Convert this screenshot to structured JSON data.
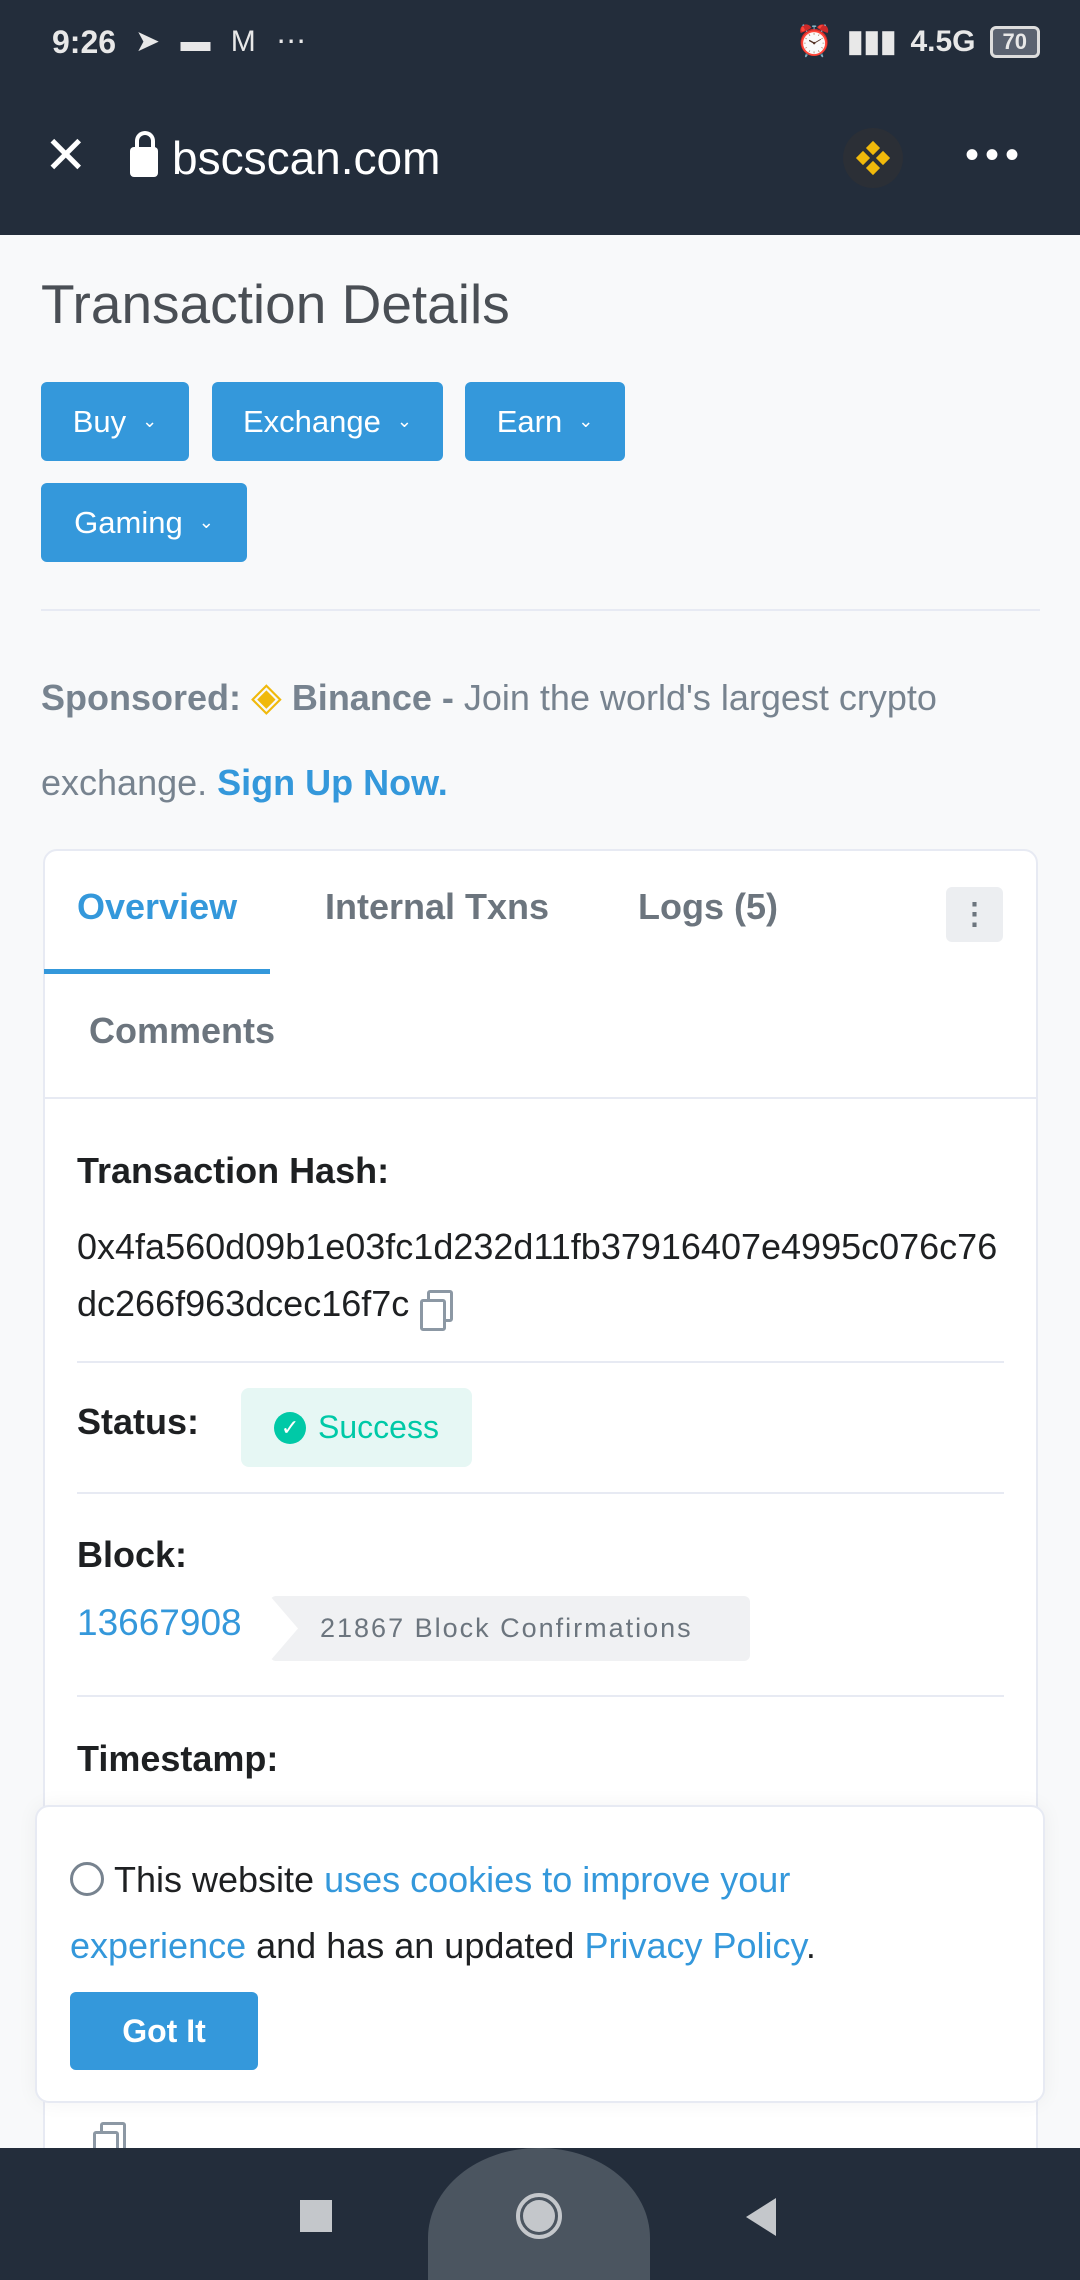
{
  "status_bar": {
    "time": "9:26",
    "network": "4.5G",
    "battery": "70"
  },
  "browser": {
    "url": "bscscan.com"
  },
  "page": {
    "title": "Transaction Details"
  },
  "menu_buttons": [
    {
      "label": "Buy"
    },
    {
      "label": "Exchange"
    },
    {
      "label": "Earn"
    },
    {
      "label": "Gaming"
    }
  ],
  "sponsor": {
    "prefix": "Sponsored:",
    "brand": "Binance -",
    "text": "Join the world's largest crypto exchange.",
    "cta": "Sign Up Now."
  },
  "tabs": [
    {
      "label": "Overview",
      "active": true
    },
    {
      "label": "Internal Txns"
    },
    {
      "label": "Logs (5)"
    },
    {
      "label": "Comments"
    }
  ],
  "details": {
    "hash_label": "Transaction Hash:",
    "hash": "0x4fa560d09b1e03fc1d232d11fb37916407e4995c076c76dc266f963dcec16f7c",
    "status_label": "Status:",
    "status": "Success",
    "block_label": "Block:",
    "block": "13667908",
    "confirmations": "21867 Block Confirmations",
    "timestamp_label": "Timestamp:"
  },
  "cookie": {
    "t1": "This website",
    "l1": "uses cookies to improve your experience",
    "t2": "and has an updated",
    "l2": "Privacy Policy",
    "t3": ".",
    "button": "Got It"
  },
  "colors": {
    "accent": "#3498db",
    "success": "#00c9a7",
    "header": "#232d3b",
    "binance": "#f0b90b"
  }
}
